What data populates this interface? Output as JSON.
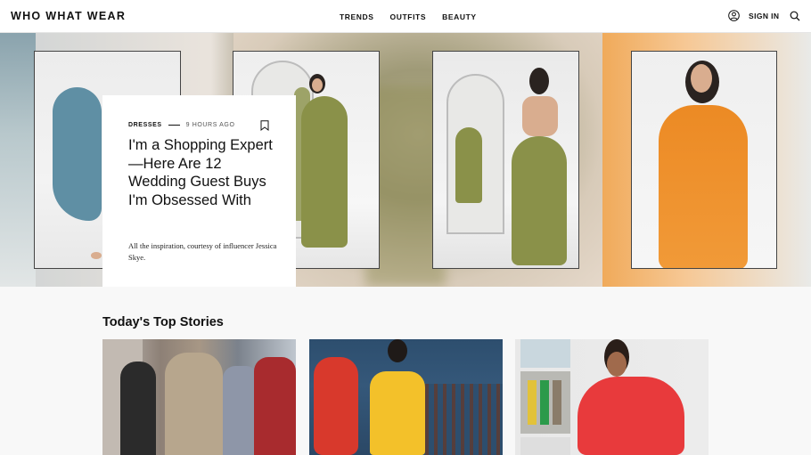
{
  "header": {
    "logo": "WHO WHAT WEAR",
    "nav": [
      "TRENDS",
      "OUTFITS",
      "BEAUTY"
    ],
    "sign_in": "SIGN IN",
    "icons": {
      "user": "user-icon",
      "search": "search-icon"
    }
  },
  "hero": {
    "category": "DRESSES",
    "time": "9 HOURS AGO",
    "title": "I'm a Shopping Expert—Here Are 12 Wedding Guest Buys I'm Obsessed With",
    "dek": "All the inspiration, courtesy of influencer Jessica Skye.",
    "icons": {
      "bookmark": "bookmark-icon"
    }
  },
  "top_stories": {
    "title": "Today's Top Stories"
  },
  "colors": {
    "text": "#111111",
    "stories_bg": "#f8f8f8",
    "orange_dress": "#ec8a24",
    "green_dress": "#8a9149"
  }
}
